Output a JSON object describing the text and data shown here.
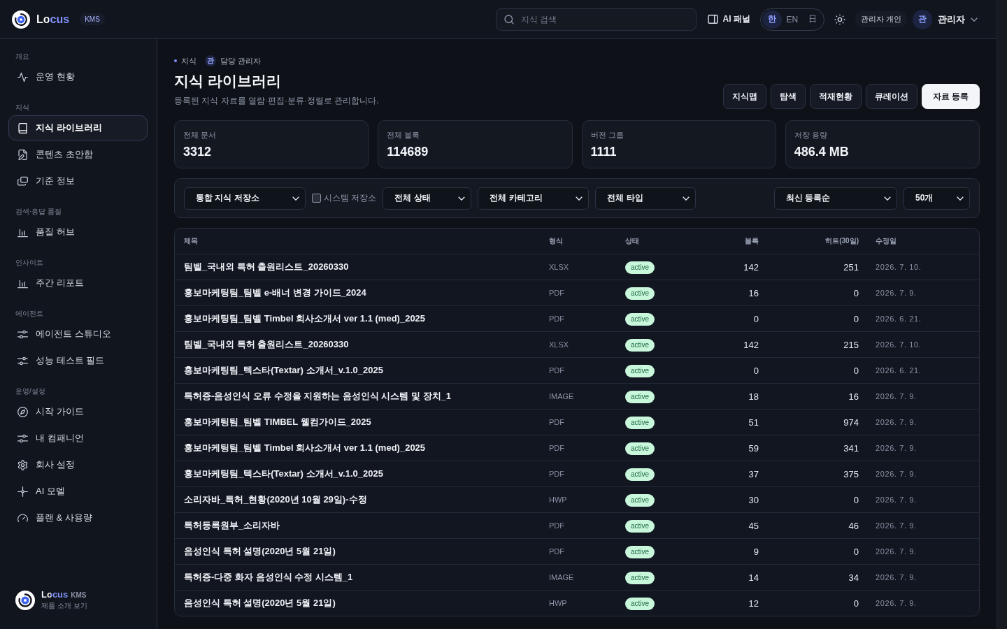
{
  "header": {
    "brand": "Locus",
    "brand_badge": "KMS",
    "search": {
      "placeholder": "지식 검색"
    },
    "ai_panel_button": "AI 패널",
    "languages": [
      {
        "label": "한",
        "selected": true
      },
      {
        "label": "EN",
        "selected": false
      },
      {
        "label": "日",
        "selected": false
      }
    ],
    "workspace_badge": "관리자 개인",
    "user": {
      "avatar": "관",
      "name": "관리자"
    }
  },
  "sidebar": {
    "sections": [
      {
        "title": "개요",
        "items": [
          {
            "label": "운영 현황",
            "selected": false
          }
        ]
      },
      {
        "title": "지식",
        "items": [
          {
            "label": "지식 라이브러리",
            "selected": true
          },
          {
            "label": "콘텐츠 초안함",
            "selected": false
          },
          {
            "label": "기준 정보",
            "selected": false
          }
        ]
      },
      {
        "title": "검색·응답 품질",
        "items": [
          {
            "label": "품질 허브",
            "selected": false
          }
        ]
      },
      {
        "title": "인사이트",
        "items": [
          {
            "label": "주간 리포트",
            "selected": false
          }
        ]
      },
      {
        "title": "에이전트",
        "items": [
          {
            "label": "에이전트 스튜디오",
            "selected": false
          },
          {
            "label": "성능 테스트 필드",
            "selected": false
          }
        ]
      },
      {
        "title": "운영/설정",
        "items": [
          {
            "label": "시작 가이드",
            "selected": false
          },
          {
            "label": "내 컴패니언",
            "selected": false
          },
          {
            "label": "회사 설정",
            "selected": false
          },
          {
            "label": "AI 모델",
            "selected": false
          },
          {
            "label": "플랜 & 사용량",
            "selected": false
          }
        ]
      }
    ],
    "footer": {
      "brand": "Locus",
      "badge": "KMS",
      "link": "제품 소개 보기"
    }
  },
  "page": {
    "breadcrumb": {
      "section": "지식",
      "owner_avatar": "관",
      "owner": "담당 관리자"
    },
    "title": "지식 라이브러리",
    "subtitle": "등록된 지식 자료를 열람·편집·분류·정렬로 관리합니다.",
    "actions": [
      {
        "label": "지식맵",
        "kind": "secondary"
      },
      {
        "label": "탐색",
        "kind": "secondary"
      },
      {
        "label": "적재현황",
        "kind": "secondary"
      },
      {
        "label": "큐레이션",
        "kind": "secondary"
      },
      {
        "label": "자료 등록",
        "kind": "primary"
      }
    ],
    "stats": [
      {
        "label": "전체 문서",
        "value": "3312"
      },
      {
        "label": "전체 블록",
        "value": "114689"
      },
      {
        "label": "버전 그룹",
        "value": "1111"
      },
      {
        "label": "저장 용량",
        "value": "486.4 MB"
      }
    ],
    "filters": [
      {
        "kind": "select",
        "value": "통합 지식 저장소"
      },
      {
        "kind": "checkbox",
        "label": "시스템 저장소",
        "checked": false
      },
      {
        "kind": "select",
        "value": "전체 상태"
      },
      {
        "kind": "select",
        "value": "전체 카테고리"
      },
      {
        "kind": "select",
        "value": "전체 타입"
      }
    ],
    "sort": [
      {
        "kind": "select",
        "value": "최신 등록순"
      },
      {
        "kind": "select",
        "value": "50개"
      }
    ],
    "table": {
      "columns": [
        "제목",
        "형식",
        "상태",
        "블록",
        "히트(30일)",
        "수정일"
      ],
      "rows": [
        {
          "title": "팀벨_국내외 특허 출원리스트_20260330",
          "format": "XLSX",
          "status": "active",
          "blocks": "142",
          "hits": "251",
          "updated": "2026. 7. 10."
        },
        {
          "title": "홍보마케팅팀_팀벨 e-배너 변경 가이드_2024",
          "format": "PDF",
          "status": "active",
          "blocks": "16",
          "hits": "0",
          "updated": "2026. 7. 9."
        },
        {
          "title": "홍보마케팅팀_팀벨 Timbel 회사소개서 ver 1.1 (med)_2025",
          "format": "PDF",
          "status": "active",
          "blocks": "0",
          "hits": "0",
          "updated": "2026. 6. 21."
        },
        {
          "title": "팀벨_국내외 특허 출원리스트_20260330",
          "format": "XLSX",
          "status": "active",
          "blocks": "142",
          "hits": "215",
          "updated": "2026. 7. 10."
        },
        {
          "title": "홍보마케팅팀_텍스타(Textar) 소개서_v.1.0_2025",
          "format": "PDF",
          "status": "active",
          "blocks": "0",
          "hits": "0",
          "updated": "2026. 6. 21."
        },
        {
          "title": "특허증-음성인식 오류 수정을 지원하는 음성인식 시스템 및 장치_1",
          "format": "IMAGE",
          "status": "active",
          "blocks": "18",
          "hits": "16",
          "updated": "2026. 7. 9."
        },
        {
          "title": "홍보마케팅팀_팀벨 TIMBEL 웰컴가이드_2025",
          "format": "PDF",
          "status": "active",
          "blocks": "51",
          "hits": "974",
          "updated": "2026. 7. 9."
        },
        {
          "title": "홍보마케팅팀_팀벨 Timbel 회사소개서 ver 1.1 (med)_2025",
          "format": "PDF",
          "status": "active",
          "blocks": "59",
          "hits": "341",
          "updated": "2026. 7. 9."
        },
        {
          "title": "홍보마케팅팀_텍스타(Textar) 소개서_v.1.0_2025",
          "format": "PDF",
          "status": "active",
          "blocks": "37",
          "hits": "375",
          "updated": "2026. 7. 9."
        },
        {
          "title": "소리자바_특허_현황(2020년 10월 29일)-수정",
          "format": "HWP",
          "status": "active",
          "blocks": "30",
          "hits": "0",
          "updated": "2026. 7. 9."
        },
        {
          "title": "특허등록원부_소리자바",
          "format": "PDF",
          "status": "active",
          "blocks": "45",
          "hits": "46",
          "updated": "2026. 7. 9."
        },
        {
          "title": "음성인식 특허 설명(2020년 5월 21일)",
          "format": "PDF",
          "status": "active",
          "blocks": "9",
          "hits": "0",
          "updated": "2026. 7. 9."
        },
        {
          "title": "특허증-다중 화자 음성인식 수정 시스템_1",
          "format": "IMAGE",
          "status": "active",
          "blocks": "14",
          "hits": "34",
          "updated": "2026. 7. 9."
        },
        {
          "title": "음성인식 특허 설명(2020년 5월 21일)",
          "format": "HWP",
          "status": "active",
          "blocks": "12",
          "hits": "0",
          "updated": "2026. 7. 9."
        }
      ]
    }
  }
}
